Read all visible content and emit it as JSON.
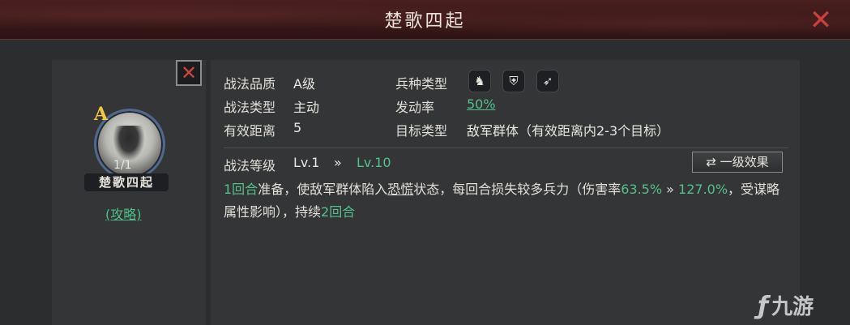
{
  "title": "楚歌四起",
  "card": {
    "grade": "A",
    "count": "1/1",
    "name": "楚歌四起",
    "strategy_link": "(攻略)"
  },
  "info": {
    "quality_label": "战法品质",
    "quality_value": "A级",
    "type_label": "战法类型",
    "type_value": "主动",
    "range_label": "有效距离",
    "range_value": "5",
    "troop_label": "兵种类型",
    "troop_icons": [
      "cavalry-icon",
      "shield-icon",
      "bow-icon"
    ],
    "rate_label": "发动率",
    "rate_value": "50%",
    "target_label": "目标类型",
    "target_value": "敌军群体（有效距离内2-3个目标）"
  },
  "level": {
    "label": "战法等级",
    "from": "Lv.1",
    "arrow": "»",
    "to": "Lv.10",
    "effect_button": "一级效果",
    "swap_glyph": "⇄"
  },
  "description": {
    "p1": "1回合",
    "p2": "准备，使敌军群体陷入",
    "p3": "恐慌",
    "p4": "状态，每回合损失较多兵力（伤害率",
    "p5": "63.5%",
    "p6": " » ",
    "p7": "127.0%",
    "p8": "，受谋略属性影响），持续",
    "p9": "2回合"
  },
  "watermark": "九游",
  "colors": {
    "accent_green": "#55c08c",
    "close_red": "#c9413a",
    "grade_gold": "#f2c842"
  }
}
